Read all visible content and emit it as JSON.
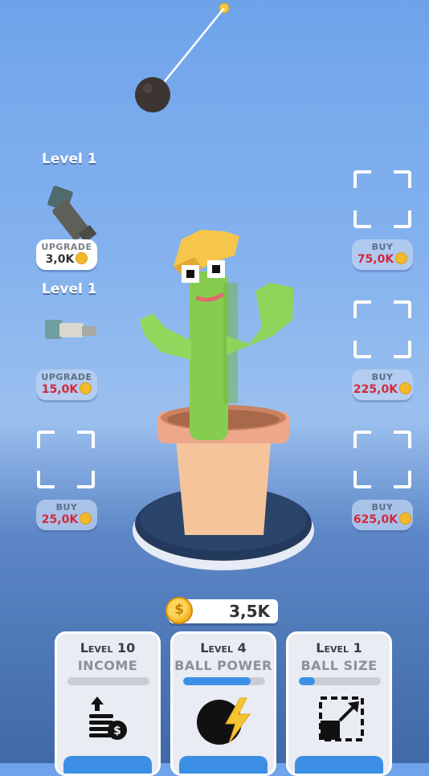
{
  "left_slots": [
    {
      "level": "Level 1",
      "button_title": "Upgrade",
      "price": "3,0K",
      "style": "affordable"
    },
    {
      "level": "Level 1",
      "button_title": "Upgrade",
      "price": "15,0K",
      "style": "unaffordable"
    },
    {
      "button_title": "Buy",
      "price": "25,0K",
      "style": "unaffordable"
    }
  ],
  "right_slots": [
    {
      "button_title": "Buy",
      "price": "75,0K",
      "style": "unaffordable"
    },
    {
      "button_title": "Buy",
      "price": "225,0K",
      "style": "unaffordable"
    },
    {
      "button_title": "Buy",
      "price": "625,0K",
      "style": "unaffordable"
    }
  ],
  "balance": {
    "value": "3,5K"
  },
  "cards": [
    {
      "level": "Level 10",
      "name": "Income",
      "progress": 0.0,
      "icon": "coin-stack-icon"
    },
    {
      "level": "Level 4",
      "name": "Ball Power",
      "progress": 0.82,
      "icon": "ball-power-icon"
    },
    {
      "level": "Level 1",
      "name": "Ball Size",
      "progress": 0.2,
      "icon": "ball-size-icon"
    }
  ],
  "colors": {
    "accent_blue": "#3d8fe6",
    "price_red": "#d4283a",
    "coin_gold": "#f2b92b",
    "cactus_green": "#8fd35a"
  }
}
